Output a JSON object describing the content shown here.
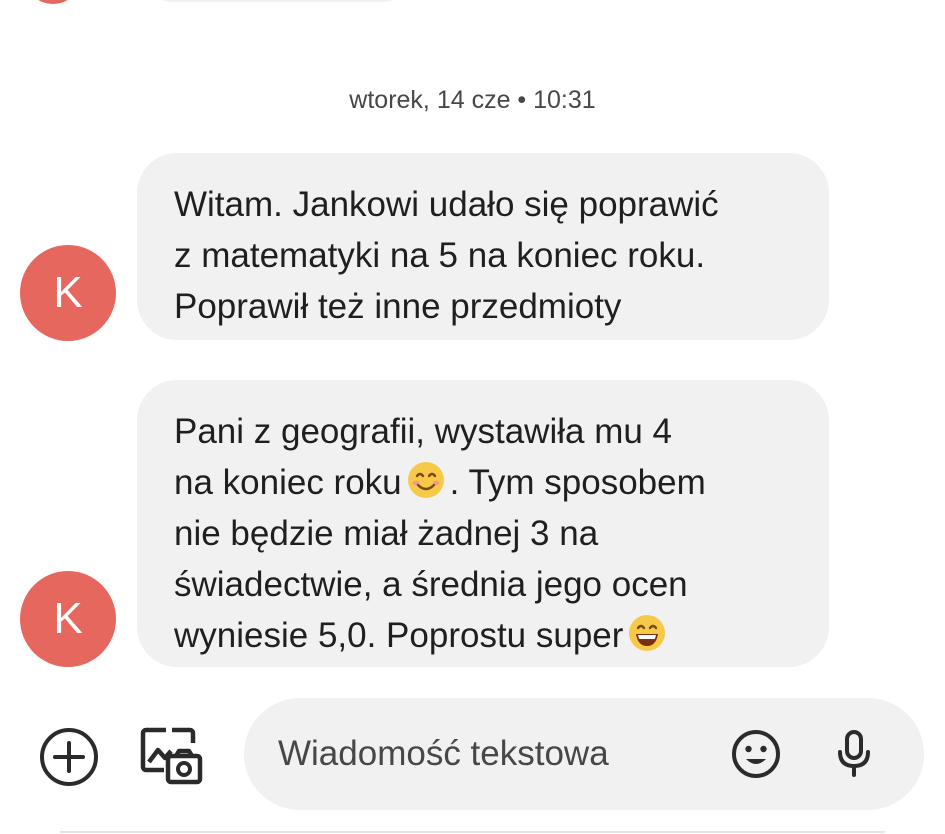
{
  "thread": {
    "timestamp": "wtorek, 14 cze • 10:31",
    "messages": [
      {
        "avatar_letter": "K",
        "lines": [
          "Witam. Jankowi udało się poprawić",
          "z matematyki na 5 na koniec roku.",
          "Poprawił też inne przedmioty"
        ]
      },
      {
        "avatar_letter": "K",
        "lines": [
          "Pani z geografii, wystawiła mu 4",
          "na koniec roku",
          ". Tym sposobem",
          "nie będzie miał żadnej 3 na",
          "świadectwie, a średnia jego ocen",
          "wyniesie 5,0. Poprostu super"
        ]
      }
    ]
  },
  "compose": {
    "placeholder": "Wiadomość tekstowa",
    "icons": [
      "add-circle-icon",
      "gallery-icon",
      "emoji-icon",
      "microphone-icon"
    ]
  },
  "colors": {
    "avatar": "#e5675d",
    "bubble": "#f1f1f1",
    "text": "#1f1f1f",
    "emoji": "#f7c948"
  }
}
